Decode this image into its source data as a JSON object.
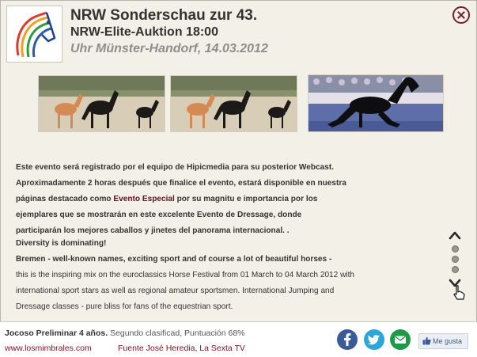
{
  "header": {
    "title_line1": "NRW Sonderschau zur 43.",
    "title_line2": "NRW-Elite-Auktion 18:00",
    "title_line3": "Uhr Münster-Handorf, 14.03.2012"
  },
  "icons": {
    "close": "close-icon",
    "logo": "horse-head-logo",
    "pager_up": "chevron-up-icon",
    "pager_down": "chevron-down-icon",
    "facebook": "facebook-icon",
    "twitter": "twitter-icon",
    "email": "email-icon",
    "like": "thumbs-up-icon"
  },
  "colors": {
    "accent": "#7a1f2b",
    "link": "#7a1327",
    "background": "#f3f0e7",
    "facebook": "#3b5b98",
    "twitter": "#2aa6dd",
    "email": "#1b9b45"
  },
  "description_es": {
    "before_highlight": "Este evento será registrado por el equipo de Hipicmedia para su posterior Webcast. Aproximadamente 2 horas después que finalice el evento, estará disponible en nuestra páginas destacado como ",
    "highlight": "Evento Especial",
    "after_highlight": " por su magnitu e importancia por los ejemplares que se mostrarán en este excelente Evento de Dressage, donde participarán los mejores caballos y jinetes del panorama internacional. ."
  },
  "description_en": {
    "heading": "Diversity is dominating!",
    "subheading": "Bremen - well-known names, exciting sport and of course a lot of beautiful horses -",
    "body": "this is the inspiring mix on the euroclassics Horse Festival from 01 March to 04 March 2012 with international sport stars as well as regional amateur sportsmen. International Jumping and Dressage classes - pure bliss for fans of the equestrian sport."
  },
  "pager": {
    "page_count": 3
  },
  "footer": {
    "horse_name": "Jocoso Preliminar 4 años.",
    "result": " Segundo clasificad, Puntuación 68%",
    "link": "www.losmimbrales.com",
    "source": "Fuente José Heredia, La Sexta TV",
    "like_label": "Me gusta"
  }
}
